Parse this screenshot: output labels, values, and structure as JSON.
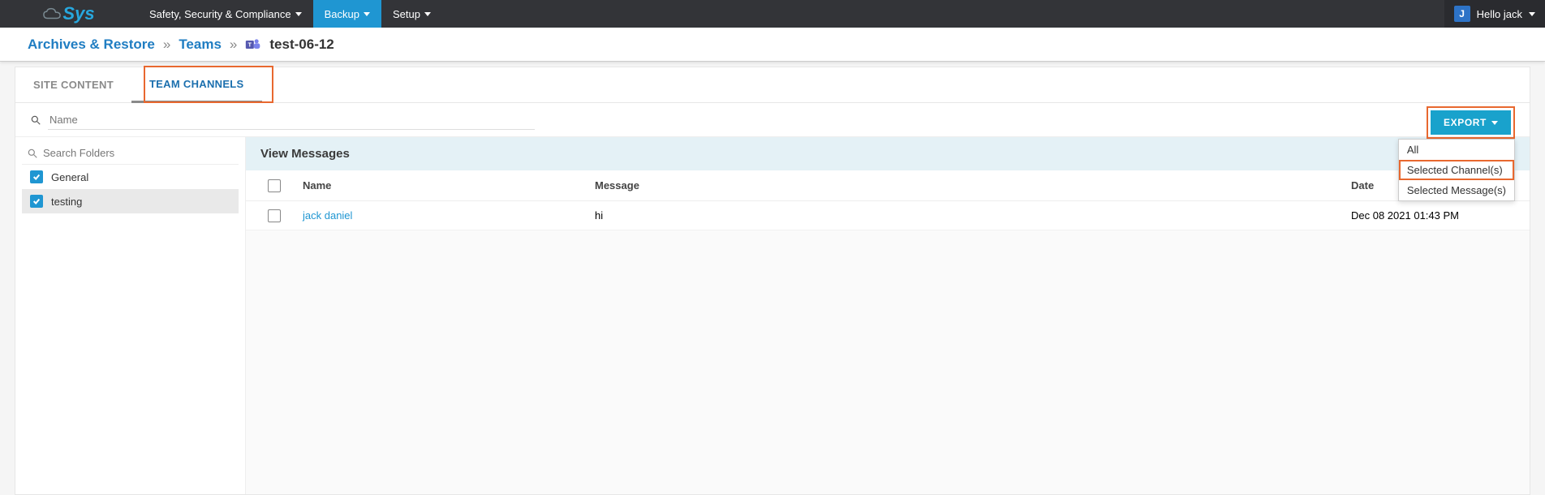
{
  "nav": {
    "items": [
      {
        "label": "Safety, Security & Compliance",
        "active": false
      },
      {
        "label": "Backup",
        "active": true
      },
      {
        "label": "Setup",
        "active": false
      }
    ],
    "user_initial": "J",
    "user_greeting": "Hello jack"
  },
  "breadcrumb": {
    "root": "Archives & Restore",
    "level1": "Teams",
    "title": "test-06-12"
  },
  "tabs": {
    "site_content": "SITE CONTENT",
    "team_channels": "TEAM CHANNELS"
  },
  "search": {
    "name_placeholder": "Name",
    "folders_placeholder": "Search Folders"
  },
  "export": {
    "button": "EXPORT",
    "menu": {
      "all": "All",
      "selected_channels": "Selected Channel(s)",
      "selected_messages": "Selected Message(s)"
    }
  },
  "folders": [
    {
      "label": "General",
      "checked": true,
      "selected": false
    },
    {
      "label": "testing",
      "checked": true,
      "selected": true
    }
  ],
  "messages": {
    "panel_title": "View Messages",
    "columns": {
      "name": "Name",
      "message": "Message",
      "date": "Date"
    },
    "rows": [
      {
        "name": "jack daniel",
        "message": "hi",
        "date": "Dec 08 2021 01:43 PM"
      }
    ]
  }
}
